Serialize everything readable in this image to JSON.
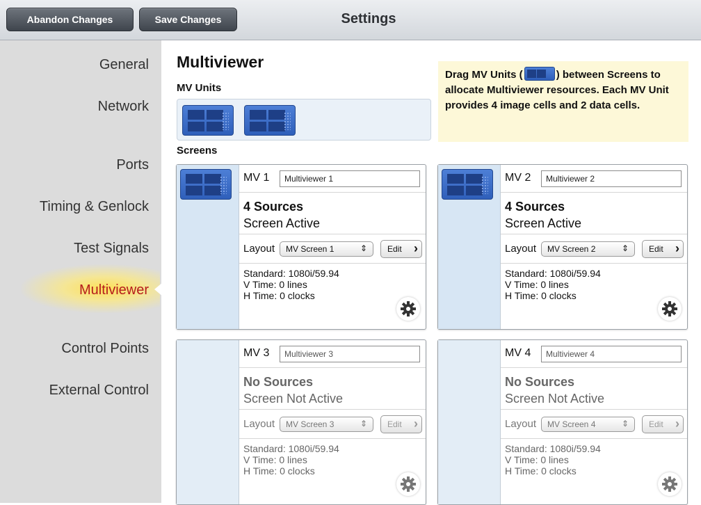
{
  "topbar": {
    "abandon_label": "Abandon Changes",
    "save_label": "Save Changes",
    "title": "Settings"
  },
  "sidebar": {
    "items": [
      {
        "label": "General"
      },
      {
        "label": "Network"
      },
      {
        "label": "Ports"
      },
      {
        "label": "Timing & Genlock"
      },
      {
        "label": "Test Signals"
      },
      {
        "label": "Multiviewer",
        "active": true
      },
      {
        "label": "Control Points"
      },
      {
        "label": "External Control"
      }
    ]
  },
  "main": {
    "title": "Multiviewer",
    "units_heading": "MV Units",
    "screens_heading": "Screens",
    "help": {
      "before": "Drag MV Units (",
      "after": ") between Screens to allocate Multiviewer resources. Each MV Unit provides 4 image cells and 2 data cells."
    }
  },
  "screens": [
    {
      "label": "MV 1",
      "name": "Multiviewer 1",
      "sources": "4 Sources",
      "state": "Screen Active",
      "layout_label": "Layout",
      "layout_value": "MV Screen 1",
      "edit_label": "Edit",
      "standard": "Standard: 1080i/59.94",
      "vtime": "V Time: 0 lines",
      "htime": "H Time: 0 clocks",
      "active": true
    },
    {
      "label": "MV 2",
      "name": "Multiviewer 2",
      "sources": "4 Sources",
      "state": "Screen Active",
      "layout_label": "Layout",
      "layout_value": "MV Screen 2",
      "edit_label": "Edit",
      "standard": "Standard: 1080i/59.94",
      "vtime": "V Time: 0 lines",
      "htime": "H Time: 0 clocks",
      "active": true
    },
    {
      "label": "MV 3",
      "name": "Multiviewer 3",
      "sources": "No Sources",
      "state": "Screen Not Active",
      "layout_label": "Layout",
      "layout_value": "MV Screen 3",
      "edit_label": "Edit",
      "standard": "Standard: 1080i/59.94",
      "vtime": "V Time: 0 lines",
      "htime": "H Time: 0 clocks",
      "active": false
    },
    {
      "label": "MV 4",
      "name": "Multiviewer 4",
      "sources": "No Sources",
      "state": "Screen Not Active",
      "layout_label": "Layout",
      "layout_value": "MV Screen 4",
      "edit_label": "Edit",
      "standard": "Standard: 1080i/59.94",
      "vtime": "V Time: 0 lines",
      "htime": "H Time: 0 clocks",
      "active": false
    }
  ],
  "icons": {
    "mv_unit": "mv-unit-icon",
    "settings": "gear-icon"
  },
  "colors": {
    "mv_unit_blue": "#3566c4",
    "active_nav": "#b51c1c",
    "help_bg": "#fdf8d8"
  }
}
